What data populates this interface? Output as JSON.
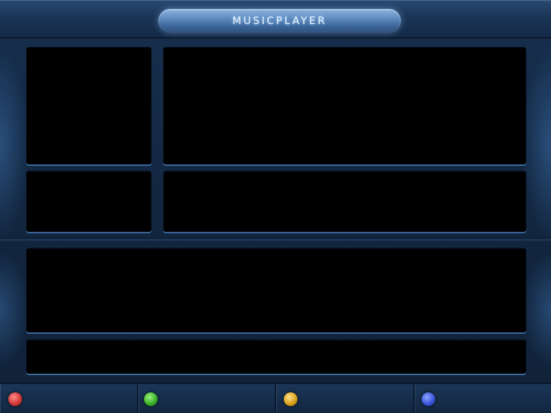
{
  "app": {
    "title": "MUSICPLAYER"
  },
  "colors": {
    "background": "#12263f",
    "panel": "#000000",
    "title_glow": "#9fd3ff"
  },
  "footer": {
    "buttons": [
      {
        "name": "red-button",
        "color": "#d23a3a"
      },
      {
        "name": "green-button",
        "color": "#3bb02a"
      },
      {
        "name": "yellow-button",
        "color": "#d9a21c"
      },
      {
        "name": "blue-button",
        "color": "#3a56d8"
      }
    ]
  }
}
